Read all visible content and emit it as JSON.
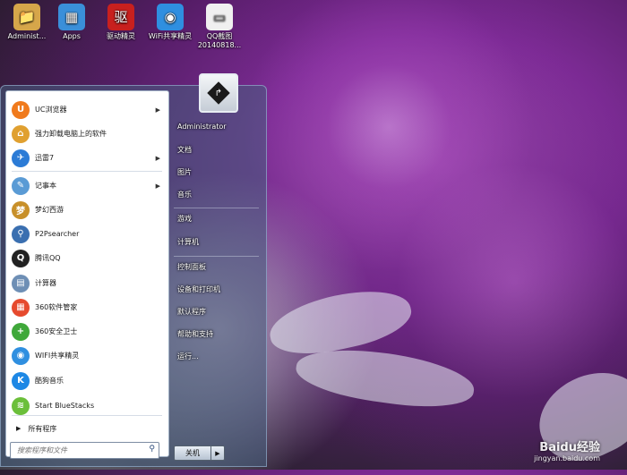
{
  "desktop_icons": [
    {
      "label": "Administ...",
      "icon": "folder-icon",
      "color": "#d6a64a",
      "glyph": "📁"
    },
    {
      "label": "Apps",
      "icon": "apps-icon",
      "color": "#3a8fd9",
      "glyph": "▦"
    },
    {
      "label": "驱动精灵",
      "icon": "driver-wizard-icon",
      "color": "#c8201e",
      "glyph": "驱"
    },
    {
      "label": "WiFi共享精灵",
      "icon": "wifi-share-icon",
      "color": "#2f8fe0",
      "glyph": "◉"
    },
    {
      "label": "QQ截图20140818...",
      "icon": "image-file-icon",
      "color": "#f0f0f0",
      "glyph": "▭"
    }
  ],
  "start_menu": {
    "programs": [
      {
        "label": "UC浏览器",
        "icon": "uc-browser-icon",
        "color": "#f07a1c",
        "glyph": "U",
        "has_arrow": true
      },
      {
        "label": "强力卸载电脑上的软件",
        "icon": "uninstall-icon",
        "color": "#e0a030",
        "glyph": "⌂",
        "has_arrow": false
      },
      {
        "label": "迅雷7",
        "icon": "thunder-icon",
        "color": "#2b7bd6",
        "glyph": "✈",
        "has_arrow": true
      },
      {
        "label": "记事本",
        "icon": "notepad-icon",
        "color": "#5a9bd5",
        "glyph": "✎",
        "has_arrow": true
      },
      {
        "label": "梦幻西游",
        "icon": "game-icon",
        "color": "#c8902a",
        "glyph": "梦",
        "has_arrow": false
      },
      {
        "label": "P2Psearcher",
        "icon": "search-app-icon",
        "color": "#3a6fb0",
        "glyph": "⚲",
        "has_arrow": false
      },
      {
        "label": "腾讯QQ",
        "icon": "qq-icon",
        "color": "#222222",
        "glyph": "Q",
        "has_arrow": false
      },
      {
        "label": "计算器",
        "icon": "calculator-icon",
        "color": "#6e8fb5",
        "glyph": "▤",
        "has_arrow": false
      },
      {
        "label": "360软件管家",
        "icon": "software-manager-icon",
        "color": "#e64a2e",
        "glyph": "▦",
        "has_arrow": false
      },
      {
        "label": "360安全卫士",
        "icon": "security-guard-icon",
        "color": "#3fa83a",
        "glyph": "+",
        "has_arrow": false
      },
      {
        "label": "WIFI共享精灵",
        "icon": "wifi-share-icon",
        "color": "#2f8fe0",
        "glyph": "◉",
        "has_arrow": false
      },
      {
        "label": "酷狗音乐",
        "icon": "kugou-music-icon",
        "color": "#1e88e5",
        "glyph": "K",
        "has_arrow": false
      },
      {
        "label": "Start BlueStacks",
        "icon": "bluestacks-icon",
        "color": "#6bbf3a",
        "glyph": "≋",
        "has_arrow": false
      }
    ],
    "all_programs_label": "所有程序",
    "search_placeholder": "搜索程序和文件",
    "right_items": [
      {
        "label": "Administrator"
      },
      {
        "label": "文档"
      },
      {
        "label": "图片"
      },
      {
        "label": "音乐"
      },
      {
        "label": "游戏"
      },
      {
        "label": "计算机"
      },
      {
        "label": "控制面板"
      },
      {
        "label": "设备和打印机"
      },
      {
        "label": "默认程序"
      },
      {
        "label": "帮助和支持"
      },
      {
        "label": "运行..."
      }
    ],
    "shutdown_label": "关机"
  },
  "watermark": {
    "text": "Baidu经验",
    "sub": "jingyan.baidu.com"
  }
}
